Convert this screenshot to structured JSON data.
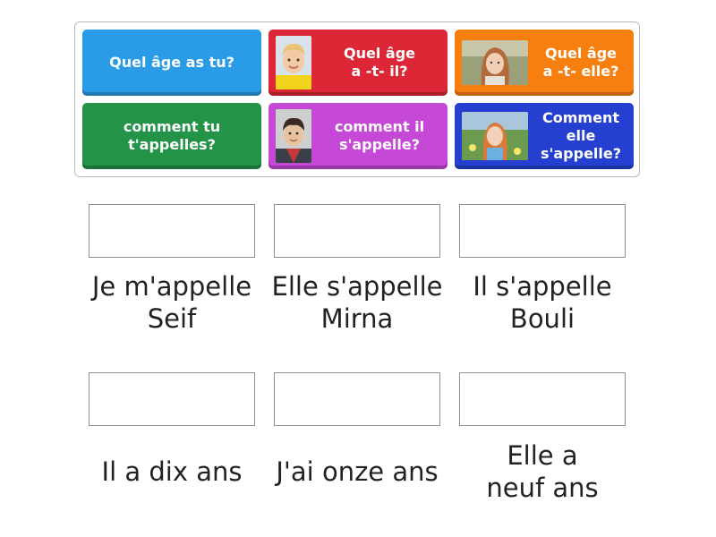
{
  "tiles": [
    {
      "label": "Quel âge as tu?",
      "color": "#2a9be6",
      "image": "none"
    },
    {
      "label": "Quel âge\na -t- il?",
      "color": "#dd2636",
      "image": "blond-boy-photo"
    },
    {
      "label": "Quel âge\na -t- elle?",
      "color": "#f77f10",
      "image": "red-haired-girl-photo"
    },
    {
      "label": "comment tu\nt'appelles?",
      "color": "#239348",
      "image": "none"
    },
    {
      "label": "comment il\ns'appelle?",
      "color": "#c548d6",
      "image": "dark-haired-boy-photo"
    },
    {
      "label": "Comment\nelle\ns'appelle?",
      "color": "#2540d0",
      "image": "girl-in-field-photo"
    }
  ],
  "answers": [
    "Je m'appelle\nSeif",
    "Elle s'appelle\nMirna",
    "Il s'appelle\nBouli",
    "Il a dix ans",
    "J'ai onze ans",
    "Elle a\nneuf ans"
  ]
}
